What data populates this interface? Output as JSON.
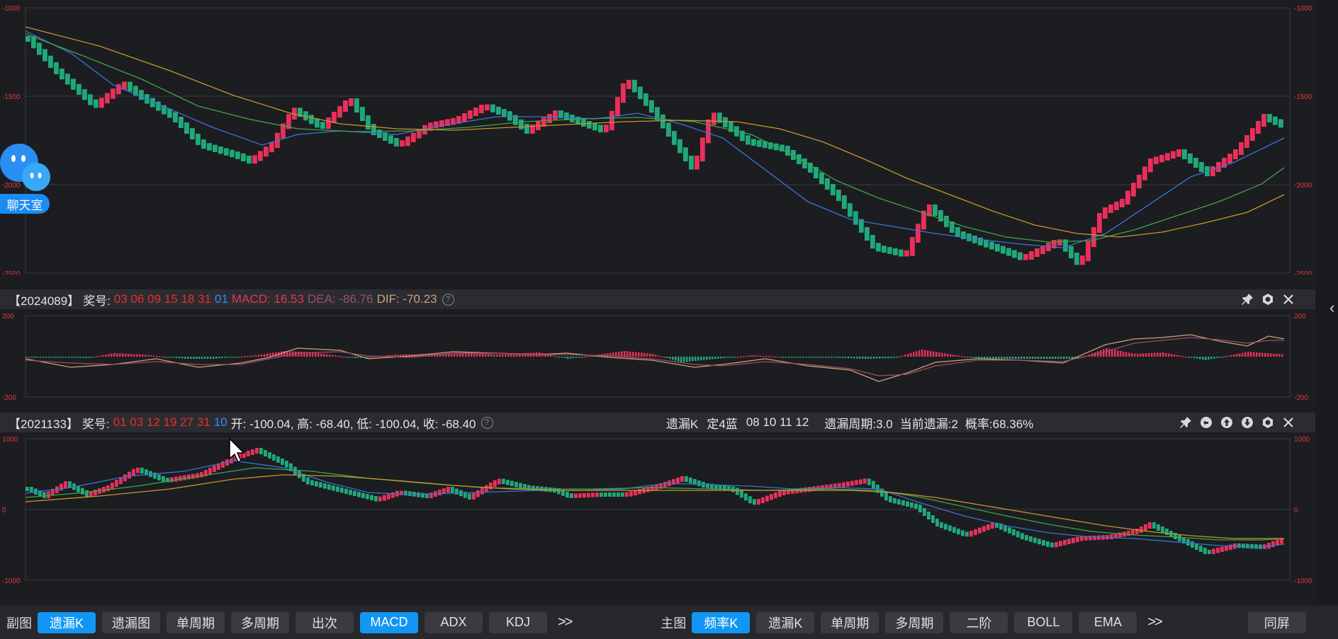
{
  "main_chart": {
    "y_ticks": [
      "-1000",
      "-1500",
      "-2000",
      "-2500"
    ],
    "y_values": [
      -1000,
      -1500,
      -2000,
      -2500
    ]
  },
  "macd_panel": {
    "period": "【2024089】",
    "prize_label": "奖号:",
    "red_numbers": "03 06 09 15 18 31",
    "blue_number": "01",
    "macd": "MACD: 16.53",
    "dea": "DEA: -86.76",
    "dif": "DIF: -70.23",
    "y_ticks": [
      "200",
      "-200"
    ]
  },
  "lower_panel": {
    "period": "【2021133】",
    "prize_label": "奖号:",
    "red_numbers": "01 03 12 19 27 31",
    "blue_number": "10",
    "ohlc": "开: -100.04, 高: -68.40, 低: -100.04, 收: -68.40",
    "type": "遗漏K",
    "rule": "定4蓝",
    "balls": "08 10 11 12",
    "cycle": "遗漏周期:3.0",
    "current": "当前遗漏:2",
    "probability": "概率:68.36%",
    "y_ticks": [
      "1000",
      "0",
      "-1000"
    ]
  },
  "chat_widget": {
    "label": "聊天室",
    "icon": "chat-bubble-icon"
  },
  "bottom_bar": {
    "sub_label": "副图",
    "sub_buttons": [
      {
        "label": "遗漏K",
        "active": true
      },
      {
        "label": "遗漏图",
        "active": false
      },
      {
        "label": "单周期",
        "active": false
      },
      {
        "label": "多周期",
        "active": false
      },
      {
        "label": "出次",
        "active": false
      },
      {
        "label": "MACD",
        "active": true
      },
      {
        "label": "ADX",
        "active": false
      },
      {
        "label": "KDJ",
        "active": false
      }
    ],
    "more_label": ">>",
    "main_label": "主图",
    "main_buttons": [
      {
        "label": "频率K",
        "active": true
      },
      {
        "label": "遗漏K",
        "active": false
      },
      {
        "label": "单周期",
        "active": false
      },
      {
        "label": "多周期",
        "active": false
      },
      {
        "label": "二阶",
        "active": false
      },
      {
        "label": "BOLL",
        "active": false
      },
      {
        "label": "EMA",
        "active": false
      }
    ],
    "sync_label": "同屏"
  },
  "colors": {
    "up": "#e8305a",
    "down": "#1fa97a",
    "ma_blue": "#3a73d6",
    "ma_green": "#3fa54a",
    "ma_orange": "#c8952d",
    "active": "#1296f3"
  }
}
